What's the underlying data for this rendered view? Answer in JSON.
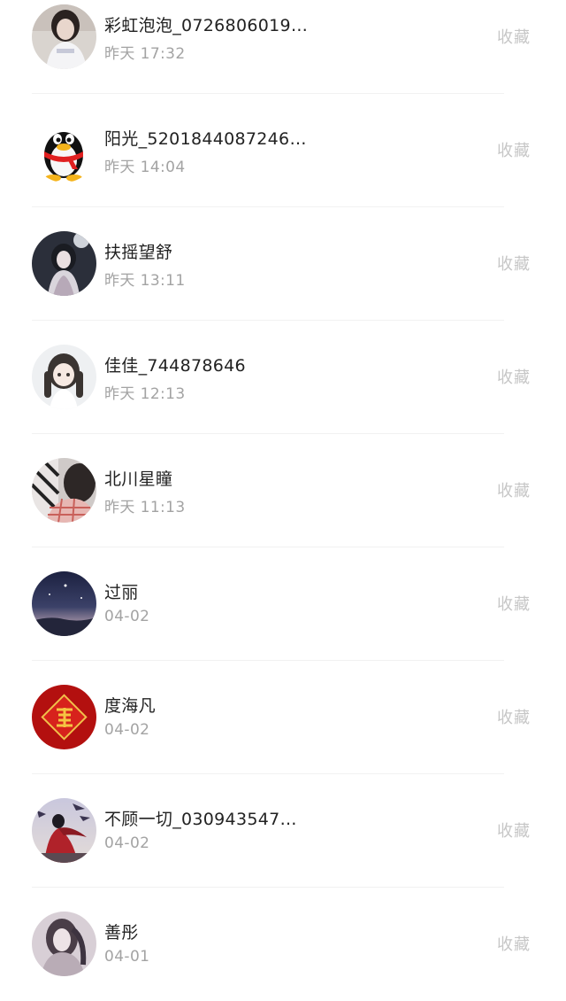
{
  "contacts": [
    {
      "name": "彩虹泡泡_0726806019…",
      "time": "昨天 17:32",
      "action": "收藏",
      "avatar_icon": "girl-photo-avatar"
    },
    {
      "name": "阳光_5201844087246…",
      "time": "昨天 14:04",
      "action": "收藏",
      "avatar_icon": "qq-penguin-avatar"
    },
    {
      "name": "扶摇望舒",
      "time": "昨天 13:11",
      "action": "收藏",
      "avatar_icon": "anime-girl-dark-avatar"
    },
    {
      "name": "佳佳_744878646",
      "time": "昨天 12:13",
      "action": "收藏",
      "avatar_icon": "anime-girl-twintails-avatar"
    },
    {
      "name": "北川星瞳",
      "time": "昨天 11:13",
      "action": "收藏",
      "avatar_icon": "plaid-photo-avatar"
    },
    {
      "name": "过丽",
      "time": "04-02",
      "action": "收藏",
      "avatar_icon": "night-sky-avatar"
    },
    {
      "name": "度海凡",
      "time": "04-02",
      "action": "收藏",
      "avatar_icon": "fu-character-avatar"
    },
    {
      "name": "不顾一切_030943547…",
      "time": "04-02",
      "action": "收藏",
      "avatar_icon": "red-dress-avatar"
    },
    {
      "name": "善彤",
      "time": "04-01",
      "action": "收藏",
      "avatar_icon": "blurred-girl-avatar"
    }
  ],
  "colors": {
    "name_text": "#222222",
    "time_text": "#a3a3a3",
    "action_text": "#c6c6c6",
    "divider": "#f1f1f1"
  }
}
